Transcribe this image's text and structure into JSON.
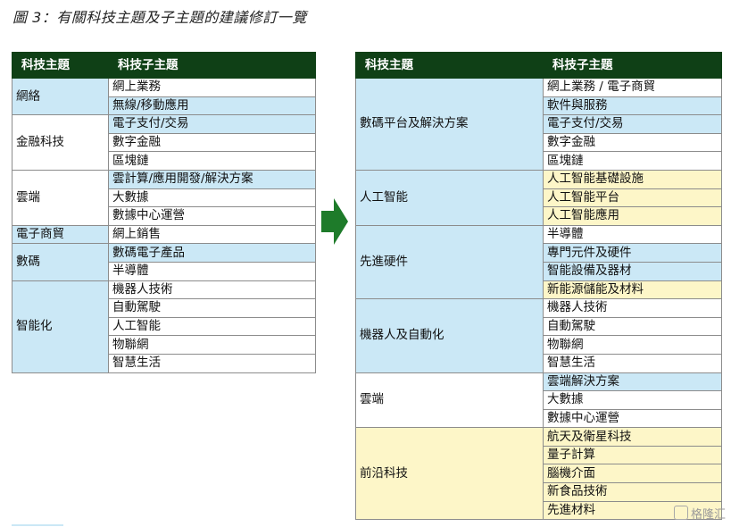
{
  "caption": "圖 3：有關科技主題及子主題的建議修訂一覽",
  "colors": {
    "header": "#0f4016",
    "blue": "#cbe8f6",
    "yellow": "#fdf6c8",
    "arrow": "#1e7b2a"
  },
  "left_table": {
    "headers": [
      "科技主題",
      "科技子主題"
    ],
    "groups": [
      {
        "topic": "網絡",
        "color": "blue",
        "subs": [
          {
            "label": "網上業務",
            "color": "white"
          },
          {
            "label": "無線/移動應用",
            "color": "blue"
          }
        ]
      },
      {
        "topic": "金融科技",
        "color": "white",
        "subs": [
          {
            "label": "電子支付/交易",
            "color": "blue"
          },
          {
            "label": "數字金融",
            "color": "white"
          },
          {
            "label": "區塊鏈",
            "color": "white"
          }
        ]
      },
      {
        "topic": "雲端",
        "color": "white",
        "subs": [
          {
            "label": "雲計算/應用開發/解決方案",
            "color": "blue"
          },
          {
            "label": "大數據",
            "color": "white"
          },
          {
            "label": "數據中心運營",
            "color": "white"
          }
        ]
      },
      {
        "topic": "電子商貿",
        "color": "blue",
        "subs": [
          {
            "label": "網上銷售",
            "color": "white"
          }
        ]
      },
      {
        "topic": "數碼",
        "color": "blue",
        "subs": [
          {
            "label": "數碼電子產品",
            "color": "blue"
          },
          {
            "label": "半導體",
            "color": "white"
          }
        ]
      },
      {
        "topic": "智能化",
        "color": "blue",
        "subs": [
          {
            "label": "機器人技術",
            "color": "white"
          },
          {
            "label": "自動駕駛",
            "color": "white"
          },
          {
            "label": "人工智能",
            "color": "white"
          },
          {
            "label": "物聯網",
            "color": "white"
          },
          {
            "label": "智慧生活",
            "color": "white"
          }
        ]
      }
    ]
  },
  "right_table": {
    "headers": [
      "科技主題",
      "科技子主題"
    ],
    "groups": [
      {
        "topic": "數碼平台及解決方案",
        "color": "blue",
        "subs": [
          {
            "label": "網上業務 / 電子商貿",
            "color": "white"
          },
          {
            "label": "軟件與服務",
            "color": "blue"
          },
          {
            "label": "電子支付/交易",
            "color": "blue"
          },
          {
            "label": "數字金融",
            "color": "white"
          },
          {
            "label": "區塊鏈",
            "color": "white"
          }
        ]
      },
      {
        "topic": "人工智能",
        "color": "blue",
        "subs": [
          {
            "label": "人工智能基礎設施",
            "color": "yellow"
          },
          {
            "label": "人工智能平台",
            "color": "yellow"
          },
          {
            "label": "人工智能應用",
            "color": "yellow"
          }
        ]
      },
      {
        "topic": "先進硬件",
        "color": "blue",
        "subs": [
          {
            "label": "半導體",
            "color": "white"
          },
          {
            "label": "專門元件及硬件",
            "color": "blue"
          },
          {
            "label": "智能設備及器材",
            "color": "blue"
          },
          {
            "label": "新能源儲能及材料",
            "color": "yellow"
          }
        ]
      },
      {
        "topic": "機器人及自動化",
        "color": "blue",
        "subs": [
          {
            "label": "機器人技術",
            "color": "white"
          },
          {
            "label": "自動駕駛",
            "color": "white"
          },
          {
            "label": "物聯網",
            "color": "white"
          },
          {
            "label": "智慧生活",
            "color": "white"
          }
        ]
      },
      {
        "topic": "雲端",
        "color": "white",
        "subs": [
          {
            "label": "雲端解決方案",
            "color": "blue"
          },
          {
            "label": "大數據",
            "color": "white"
          },
          {
            "label": "數據中心運營",
            "color": "white"
          }
        ]
      },
      {
        "topic": "前沿科技",
        "color": "yellow",
        "subs": [
          {
            "label": "航天及衛星科技",
            "color": "yellow"
          },
          {
            "label": "量子計算",
            "color": "yellow"
          },
          {
            "label": "腦機介面",
            "color": "yellow"
          },
          {
            "label": "新食品技術",
            "color": "yellow"
          },
          {
            "label": "先進材料",
            "color": "yellow"
          }
        ]
      }
    ]
  },
  "watermark": "格隆汇"
}
